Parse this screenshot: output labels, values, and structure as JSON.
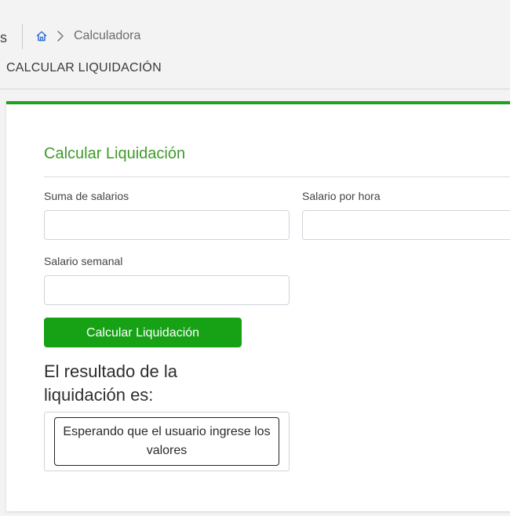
{
  "breadcrumb": {
    "previous_fragment": "s",
    "current": "Calculadora"
  },
  "page": {
    "title": "CALCULAR LIQUIDACIÓN"
  },
  "form": {
    "title": "Calcular Liquidación",
    "fields": {
      "suma_salarios": {
        "label": "Suma de salarios",
        "value": ""
      },
      "salario_hora": {
        "label": "Salario por hora",
        "value": ""
      },
      "salario_semanal": {
        "label": "Salario semanal",
        "value": ""
      }
    },
    "submit_label": "Calcular Liquidación"
  },
  "result": {
    "heading": "El resultado de la liquidación es:",
    "message": "Esperando que el usuario ingrese los valores"
  },
  "colors": {
    "accent_green": "#17a215",
    "title_green": "#3f9a2c",
    "home_icon_blue": "#2f6fd1"
  },
  "icons": {
    "home": "home-icon",
    "separator": "chevron-right-icon"
  }
}
